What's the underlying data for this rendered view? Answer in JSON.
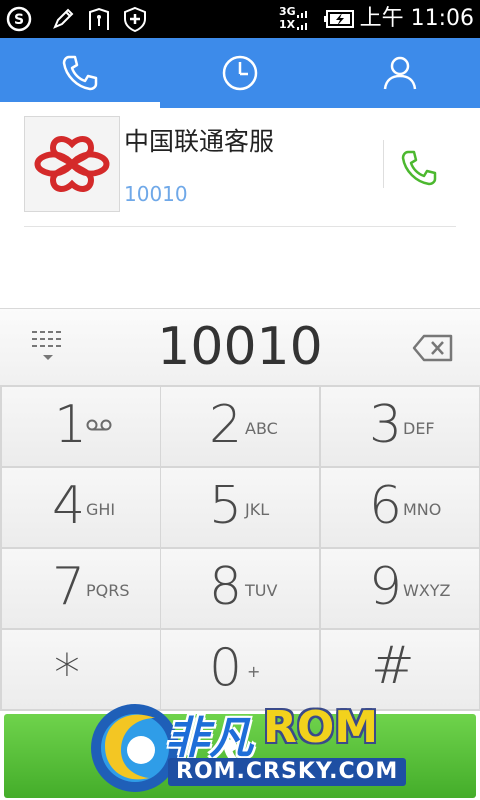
{
  "status_bar": {
    "network_top": "3G",
    "network_bottom": "1X",
    "time": "上午 11:06",
    "icons": [
      "sogou-icon",
      "pen-icon",
      "frame-icon",
      "shield-plus-icon",
      "signal-icon",
      "battery-charging-icon"
    ]
  },
  "tabs": [
    {
      "name": "phone-icon",
      "active": true
    },
    {
      "name": "clock-icon",
      "active": false
    },
    {
      "name": "person-icon",
      "active": false
    }
  ],
  "search_result": {
    "name": "中国联通客服",
    "number": "10010"
  },
  "input": {
    "digits": "10010"
  },
  "keys": [
    {
      "main": "1",
      "sub": ""
    },
    {
      "main": "2",
      "sub": "ABC"
    },
    {
      "main": "3",
      "sub": "DEF"
    },
    {
      "main": "4",
      "sub": "GHI"
    },
    {
      "main": "5",
      "sub": "JKL"
    },
    {
      "main": "6",
      "sub": "MNO"
    },
    {
      "main": "7",
      "sub": "PQRS"
    },
    {
      "main": "8",
      "sub": "TUV"
    },
    {
      "main": "9",
      "sub": "WXYZ"
    },
    {
      "main": "*",
      "sub": ""
    },
    {
      "main": "0",
      "sub": "+"
    },
    {
      "main": "#",
      "sub": ""
    }
  ],
  "watermark": {
    "cn": "非凡",
    "rom": "ROM",
    "url": "ROM.CRSKY.COM"
  },
  "colors": {
    "tabbar": "#3d8bea",
    "call_green": "#4cb82f",
    "number_blue": "#6fa8e8"
  }
}
